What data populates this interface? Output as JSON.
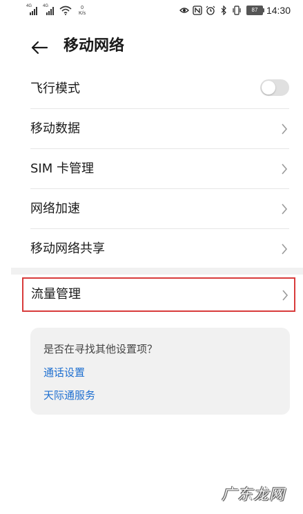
{
  "status_bar": {
    "signal1_tag": "4G",
    "signal2_tag": "4G",
    "net_speed_value": "0",
    "net_speed_unit": "K/s",
    "battery": "87",
    "time": "14:30"
  },
  "header": {
    "title": "移动网络"
  },
  "settings": {
    "airplane_mode": {
      "label": "飞行模式",
      "enabled": false
    },
    "items": [
      {
        "label": "移动数据"
      },
      {
        "label": "SIM 卡管理"
      },
      {
        "label": "网络加速"
      },
      {
        "label": "移动网络共享"
      }
    ],
    "highlighted_item": {
      "label": "流量管理"
    }
  },
  "suggestions": {
    "question": "是否在寻找其他设置项？",
    "links": [
      "通话设置",
      "天际通服务"
    ]
  },
  "watermark": {
    "text": "广东龙网"
  },
  "colors": {
    "accent_link": "#1e6fd0",
    "highlight_border": "#d83a3a",
    "card_bg": "#f1f1f1"
  }
}
